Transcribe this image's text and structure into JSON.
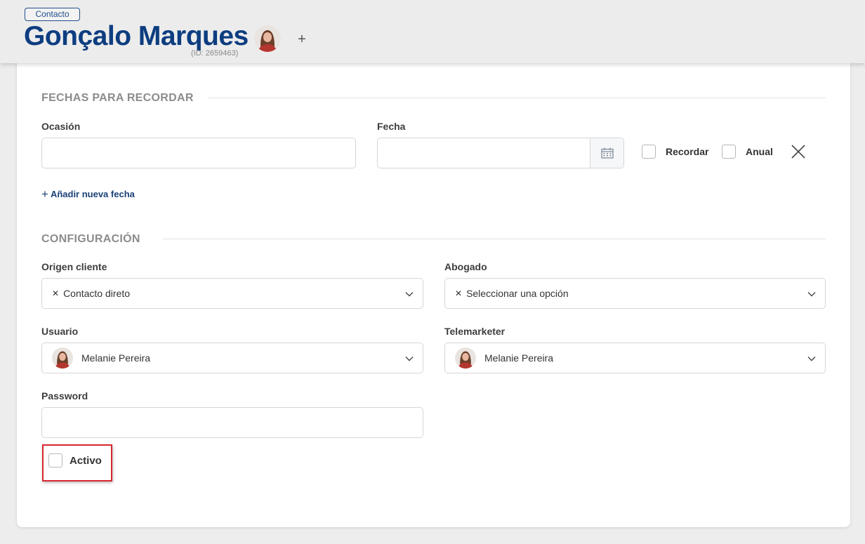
{
  "header": {
    "badge": "Contacto",
    "name": "Gonçalo Marques",
    "id_text": "(ID: 2659463)",
    "add_icon": "plus-icon"
  },
  "dates_section": {
    "title": "FECHAS PARA RECORDAR",
    "occasion_label": "Ocasión",
    "occasion_value": "",
    "date_label": "Fecha",
    "date_value": "",
    "date_icon": "calendar-icon",
    "remember_label": "Recordar",
    "remember_checked": false,
    "annual_label": "Anual",
    "annual_checked": false,
    "remove_icon": "close-icon",
    "add_date_label": "Añadir nueva fecha"
  },
  "config_section": {
    "title": "CONFIGURACIÓN",
    "origin_label": "Origen cliente",
    "origin_value": "Contacto direto",
    "lawyer_label": "Abogado",
    "lawyer_value": "Seleccionar una opción",
    "user_label": "Usuario",
    "user_value": "Melanie Pereira",
    "telemarketer_label": "Telemarketer",
    "telemarketer_value": "Melanie Pereira",
    "password_label": "Password",
    "password_value": "",
    "active_label": "Activo",
    "active_checked": false
  },
  "colors": {
    "brand_blue": "#0d3d80",
    "link_blue": "#1a4077",
    "highlight_red": "#d7262e"
  }
}
